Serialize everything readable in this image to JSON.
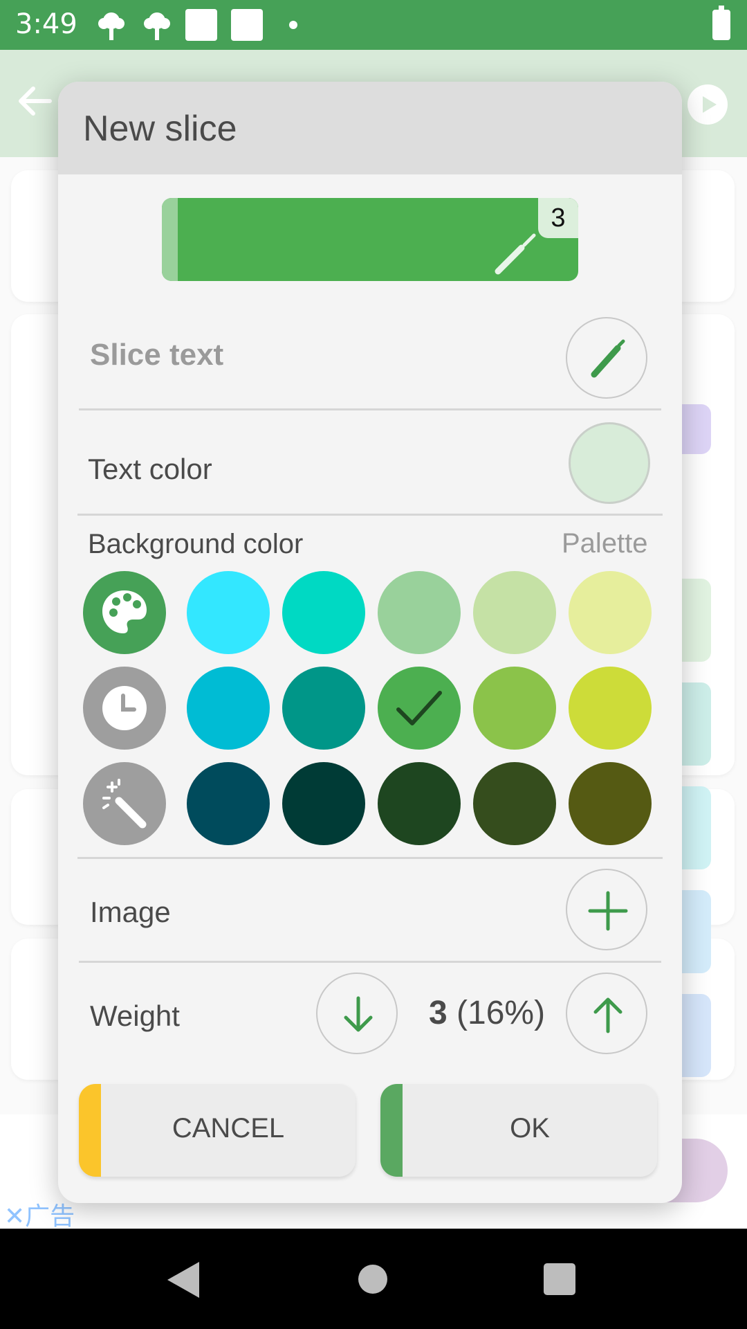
{
  "status_bar": {
    "time": "3:49"
  },
  "dialog": {
    "title": "New slice",
    "preview": {
      "weight_badge": "3",
      "color": "#4caf50",
      "strip_color": "#99d19b"
    },
    "slice_text_label": "Slice text",
    "text_color_label": "Text color",
    "text_color_value": "#d8ecd9",
    "background_color_label": "Background color",
    "palette_link": "Palette",
    "swatch_rows": [
      {
        "tool": "palette-icon",
        "tool_color": "#46a157",
        "colors": [
          "#33e7ff",
          "#00d9c3",
          "#99d19b",
          "#c5e1a5",
          "#e6ee9c"
        ]
      },
      {
        "tool": "clock-icon",
        "tool_color": "#9e9e9e",
        "colors": [
          "#00bcd4",
          "#009688",
          "#4caf50",
          "#8bc34a",
          "#cddc39"
        ]
      },
      {
        "tool": "magic-wand-icon",
        "tool_color": "#9e9e9e",
        "colors": [
          "#004b5c",
          "#003b36",
          "#1e4620",
          "#354d1d",
          "#555a13"
        ]
      }
    ],
    "selected_color": "#4caf50",
    "image_label": "Image",
    "weight_label": "Weight",
    "weight_number": "3",
    "weight_percent": " (16%)",
    "cancel_label": "CANCEL",
    "ok_label": "OK",
    "cancel_accent": "#fbc52b",
    "ok_accent": "#5aa861"
  },
  "ad": {
    "label": "广告"
  }
}
